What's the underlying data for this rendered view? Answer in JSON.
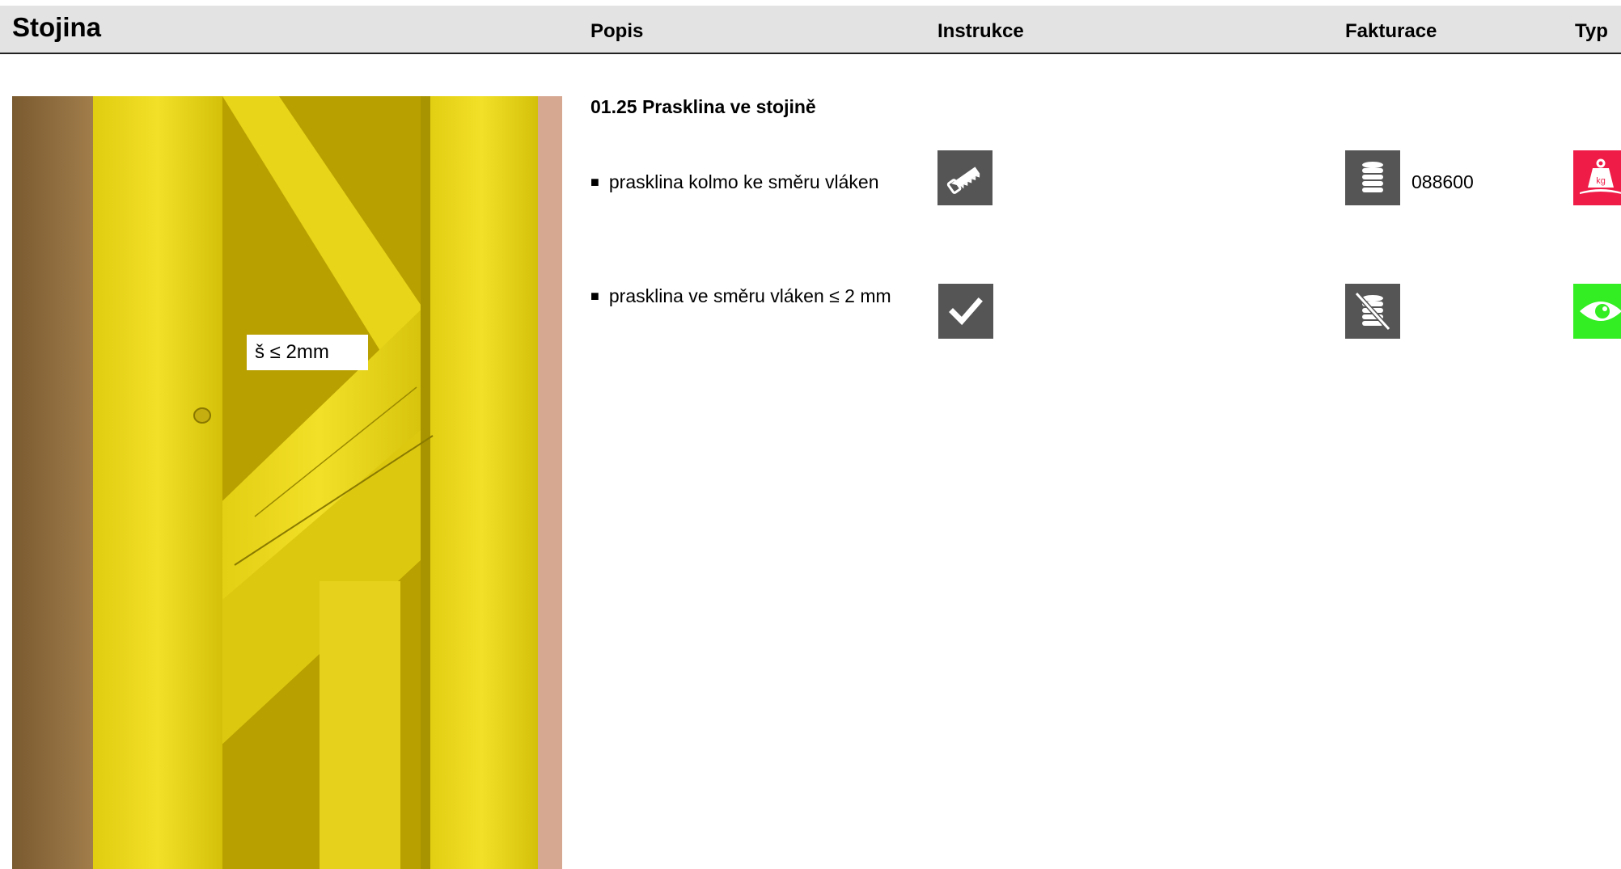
{
  "header": {
    "title": "Stojina",
    "col_popis": "Popis",
    "col_instrukce": "Instrukce",
    "col_fakturace": "Fakturace",
    "col_typ": "Typ"
  },
  "photo": {
    "label": "š ≤ 2mm"
  },
  "section": {
    "title": "01.25 Prasklina ve stojině"
  },
  "rows": [
    {
      "bullet": "■",
      "text": "prasklina kolmo ke směru vláken",
      "instruction_icon": "saw-icon",
      "billing_icon": "coins-icon",
      "billing_code": "088600",
      "type_icon": "weight-kg-icon",
      "type_color": "#ee1c47"
    },
    {
      "bullet": "■",
      "text": "prasklina ve směru vláken ≤ 2 mm",
      "instruction_icon": "checkmark-icon",
      "billing_icon": "no-coins-icon",
      "billing_code": "",
      "type_icon": "eye-icon",
      "type_color": "#33ee22"
    }
  ]
}
